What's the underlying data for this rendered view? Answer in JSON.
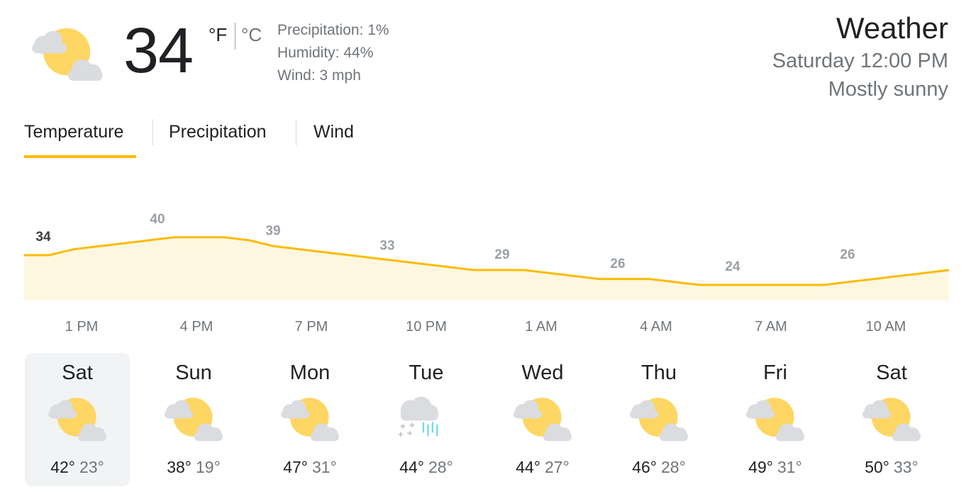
{
  "current": {
    "temperature": "34",
    "unit_f": "°F",
    "unit_c": "°C",
    "precipitation": "Precipitation: 1%",
    "humidity": "Humidity: 44%",
    "wind": "Wind: 3 mph",
    "icon": "partly-cloudy-icon"
  },
  "header": {
    "title": "Weather",
    "datetime": "Saturday 12:00 PM",
    "condition": "Mostly sunny"
  },
  "tabs": [
    {
      "label": "Temperature",
      "selected": true
    },
    {
      "label": "Precipitation",
      "selected": false
    },
    {
      "label": "Wind",
      "selected": false
    }
  ],
  "colors": {
    "accent": "#fbbc04",
    "chart_fill": "#fef7e0",
    "sun": "#fdd663",
    "cloud": "#dadce0",
    "text_primary": "#202124",
    "text_secondary": "#70757a"
  },
  "chart_data": {
    "type": "area",
    "series": [
      {
        "values": [
          34,
          34,
          36,
          37,
          38,
          39,
          40,
          40,
          40,
          39,
          37,
          36,
          35,
          34,
          33,
          32,
          31,
          30,
          29,
          29,
          29,
          28,
          27,
          26,
          26,
          26,
          25,
          24,
          24,
          24,
          24,
          24,
          24,
          25,
          26,
          27,
          28,
          29
        ]
      }
    ],
    "value_labels": [
      "34",
      "40",
      "39",
      "33",
      "29",
      "26",
      "24",
      "26"
    ],
    "time_labels": [
      "1 PM",
      "4 PM",
      "7 PM",
      "10 PM",
      "1 AM",
      "4 AM",
      "7 AM",
      "10 AM"
    ]
  },
  "forecast": [
    {
      "day": "Sat",
      "high": "42°",
      "low": "23°",
      "icon": "partly-cloudy-icon",
      "selected": true
    },
    {
      "day": "Sun",
      "high": "38°",
      "low": "19°",
      "icon": "partly-cloudy-icon",
      "selected": false
    },
    {
      "day": "Mon",
      "high": "47°",
      "low": "31°",
      "icon": "partly-cloudy-icon",
      "selected": false
    },
    {
      "day": "Tue",
      "high": "44°",
      "low": "28°",
      "icon": "snow-rain-icon",
      "selected": false
    },
    {
      "day": "Wed",
      "high": "44°",
      "low": "27°",
      "icon": "partly-cloudy-icon",
      "selected": false
    },
    {
      "day": "Thu",
      "high": "46°",
      "low": "28°",
      "icon": "partly-cloudy-icon",
      "selected": false
    },
    {
      "day": "Fri",
      "high": "49°",
      "low": "31°",
      "icon": "partly-cloudy-icon",
      "selected": false
    },
    {
      "day": "Sat",
      "high": "50°",
      "low": "33°",
      "icon": "partly-cloudy-icon",
      "selected": false
    }
  ]
}
